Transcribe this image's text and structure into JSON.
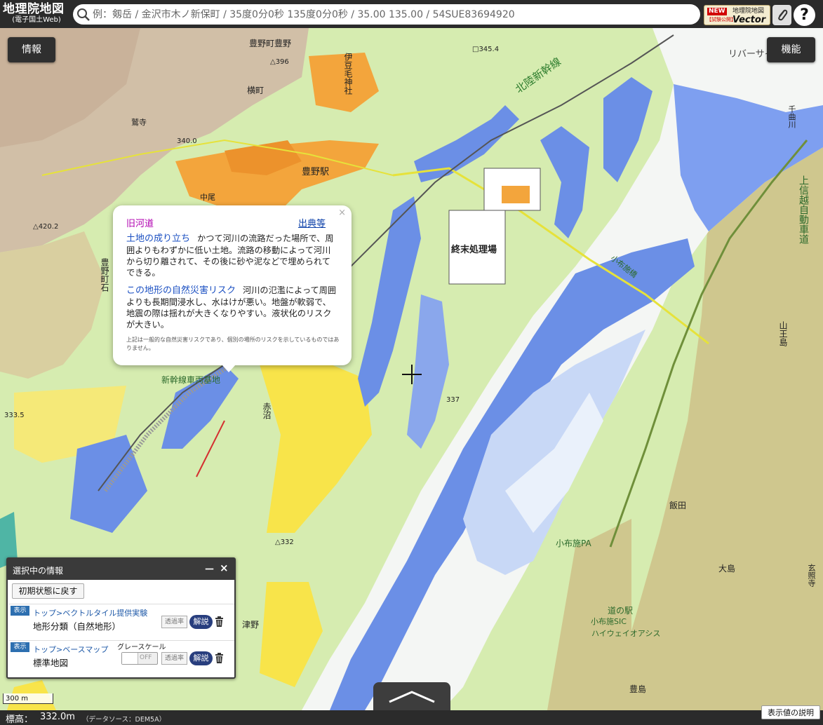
{
  "header": {
    "logo_line1": "地理院地図",
    "logo_line2": "(電子国土Web)",
    "search_placeholder": "例：剱岳 / 金沢市木ノ新保町 / 35度0分0秒 135度0分0秒 / 35.00 135.00 / 54SUE83694920",
    "vector_new": "NEW",
    "vector_trial": "【試験公開】",
    "vector_gsi": "地理院地図",
    "vector_name": "Vector",
    "help": "?"
  },
  "buttons": {
    "info": "情報",
    "functions": "機能"
  },
  "popup": {
    "close": "×",
    "title": "旧河道",
    "source_link": "出典等",
    "section1_heading": "土地の成り立ち",
    "section1_text": "かつて河川の流路だった場所で、周囲よりもわずかに低い土地。流路の移動によって河川から切り離されて、その後に砂や泥などで埋められてできる。",
    "section2_heading": "この地形の自然災害リスク",
    "section2_text": "河川の氾濫によって周囲よりも長期間浸水し、水はけが悪い。地盤が軟弱で、地震の際は揺れが大きくなりやすい。液状化のリスクが大きい。",
    "note": "上記は一般的な自然災害リスクであり、個別の場所のリスクを示しているものではありません。"
  },
  "panel": {
    "title": "選択中の情報",
    "minimize": "－",
    "close": "×",
    "reset": "初期状態に戻す",
    "layers": [
      {
        "show": "表示",
        "path": "トップ>ベクトルタイル提供実験",
        "name": "地形分類（自然地形）",
        "transparency": "透過率",
        "explain": "解説"
      },
      {
        "show": "表示",
        "path": "トップ>ベースマップ",
        "name": "標準地図",
        "grayscale": "グレースケール",
        "toggle": "OFF",
        "transparency": "透過率",
        "explain": "解説"
      }
    ]
  },
  "scale": "300 m",
  "status": {
    "label": "標高：",
    "value": "332.0m",
    "source": "（データソース：DEM5A）"
  },
  "value_desc_button": "表示値の説明",
  "map_labels": {
    "toyono": "豊野町豊野",
    "izuke": "伊豆毛神社",
    "yokomachi": "横町",
    "washi": "鷲寺",
    "toyono_station": "豊野駅",
    "nakao": "中尾",
    "hokuriku": "北陸新幹線",
    "chikuma": "千曲川",
    "sewage": "終末処理場",
    "shinkansen_base": "新幹線車両基地",
    "akanuma": "赤沼",
    "toyonomachi_ishi": "豊野町石",
    "obuse_pa": "小布施PA",
    "iida": "飯田",
    "oshima": "大島",
    "genshoji": "玄照寺",
    "michinoeki": "道の駅",
    "obuse_sic": "小布施SIC",
    "highway_oasis": "ハイウェイオアシス",
    "tsuno": "津野",
    "toyoshima": "豊島",
    "sanno": "山王島",
    "liberty": "リバーサイ",
    "joshinetsu": "上信越自動車道",
    "obuse_bridge": "小布施橋",
    "el396": "△396",
    "el3454": "□345.4",
    "el3400": "340.0",
    "el4202": "△420.2",
    "el3335": "333.5",
    "el337": "337",
    "el332": "△332"
  },
  "colors": {
    "lowland_green": "#d6ecb0",
    "old_channel_blue": "#6b8fe6",
    "floodplain_light": "#c8d8f6",
    "levee_yellow": "#f8e44a",
    "fan_orange": "#f3a53c",
    "terrace_olive": "#c9c48a",
    "mountain_brown": "#c9b29a",
    "riverbed_white": "#f4f6f4"
  }
}
